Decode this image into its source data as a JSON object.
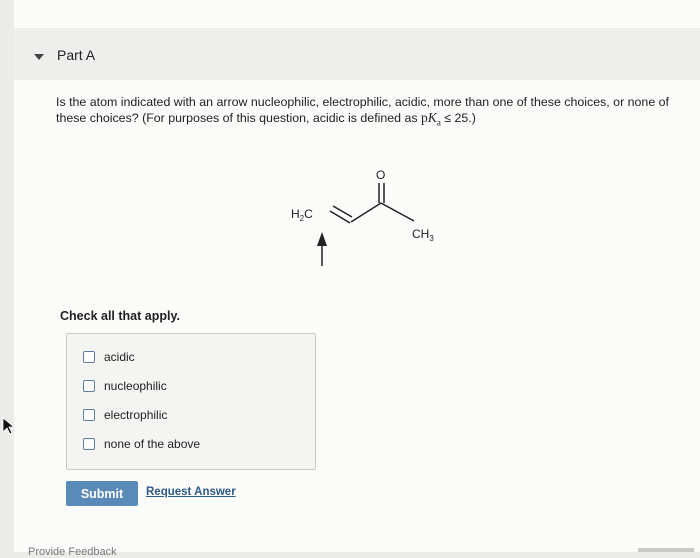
{
  "part": {
    "title": "Part A"
  },
  "question": {
    "text_before": "Is the atom indicated with an arrow nucleophilic, electrophilic, acidic, more than one of these choices, or none of these choices? (For purposes of this question, acidic is defined as ",
    "pka_p": "p",
    "pka_K": "K",
    "pka_sub": "a",
    "text_after": " ≤ 25.)"
  },
  "molecule": {
    "oxygen_label": "O",
    "h2c_H": "H",
    "h2c_sub": "2",
    "h2c_C": "C",
    "ch3_CH": "CH",
    "ch3_sub": "3"
  },
  "instructions": {
    "check_all": "Check all that apply."
  },
  "options": [
    {
      "label": "acidic",
      "checked": false
    },
    {
      "label": "nucleophilic",
      "checked": false
    },
    {
      "label": "electrophilic",
      "checked": false
    },
    {
      "label": "none of the above",
      "checked": false
    }
  ],
  "actions": {
    "submit_label": "Submit",
    "request_answer_label": "Request Answer",
    "feedback_label": "Provide Feedback"
  },
  "colors": {
    "submit_bg": "#5a8ab8",
    "link": "#2d5a8a",
    "checkbox_border": "#5d7ea3",
    "panel": "#eeeeec"
  }
}
